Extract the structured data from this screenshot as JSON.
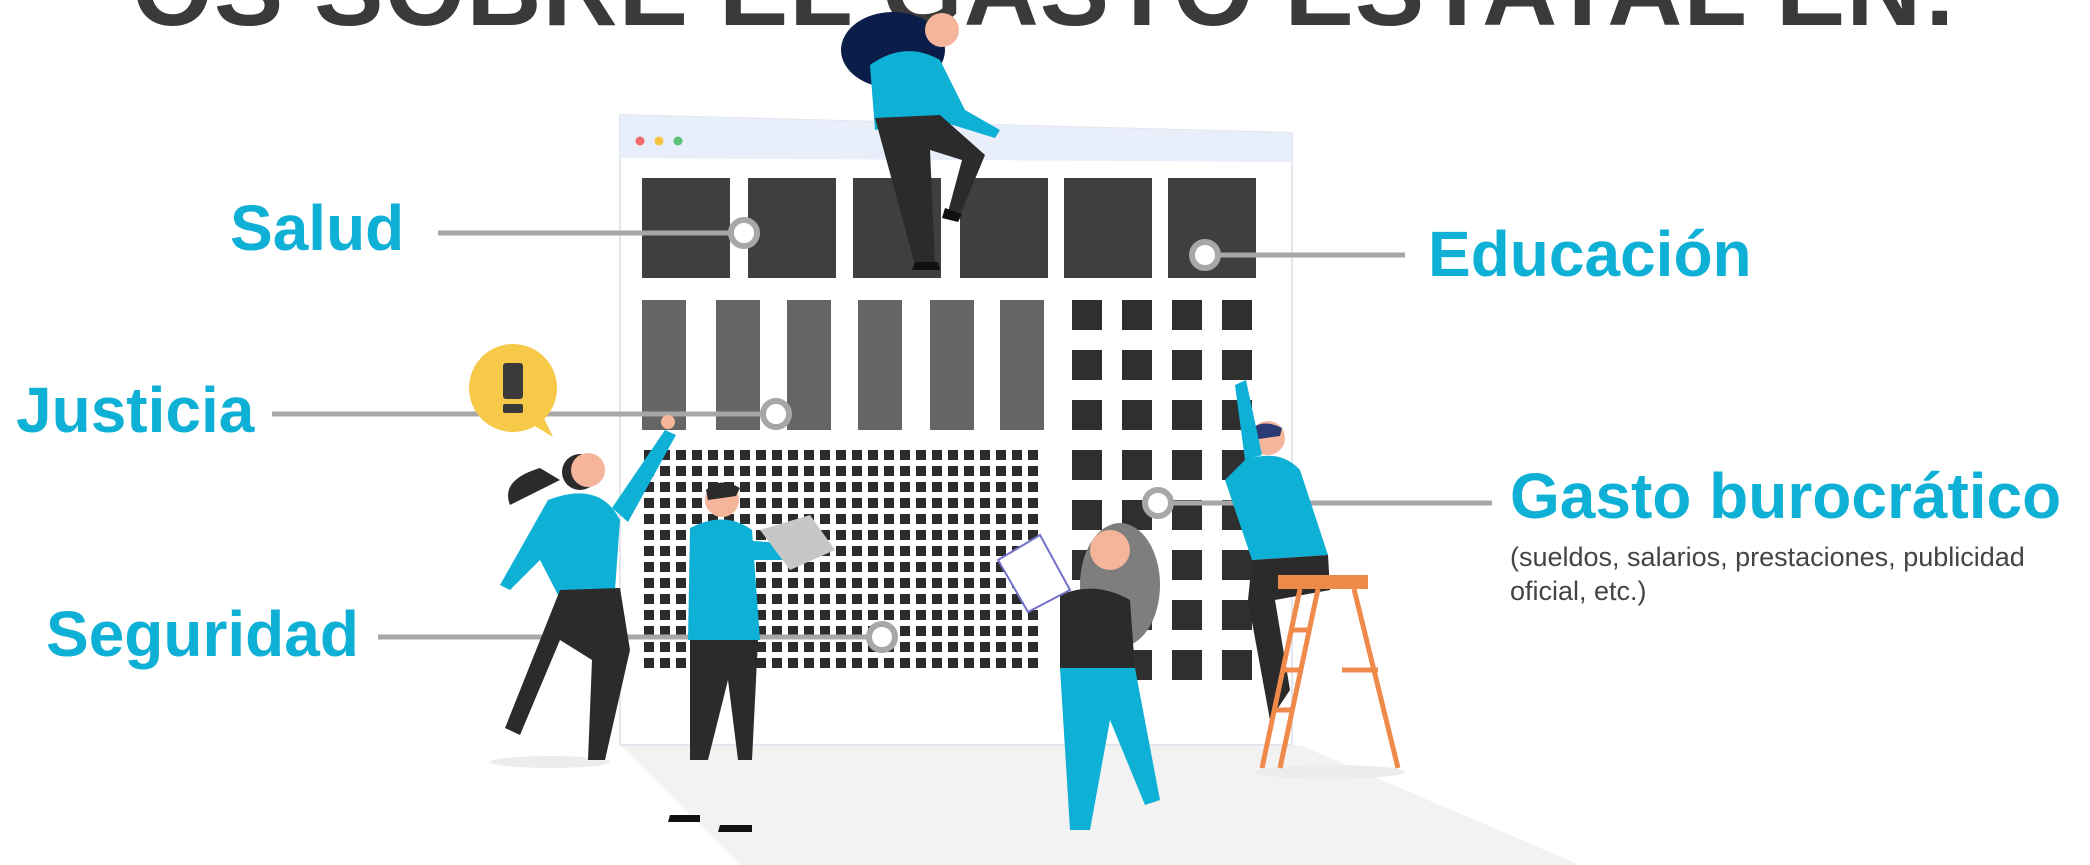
{
  "heading": "OS SOBRE EL GASTO ESTATAL EN:",
  "categories": {
    "salud": "Salud",
    "justicia": "Justicia",
    "seguridad": "Seguridad",
    "educacion": "Educación",
    "gasto": "Gasto burocrático"
  },
  "gasto_note": "(sueldos, salarios, prestaciones, publicidad oficial, etc.)",
  "icons": {
    "alert": "exclamation-bubble-icon",
    "window_dots": "window-controls-icon"
  },
  "colors": {
    "accent": "#0fb0d6",
    "dark": "#3a3a3a",
    "alert": "#f7c948",
    "ladder": "#f08a4b"
  }
}
